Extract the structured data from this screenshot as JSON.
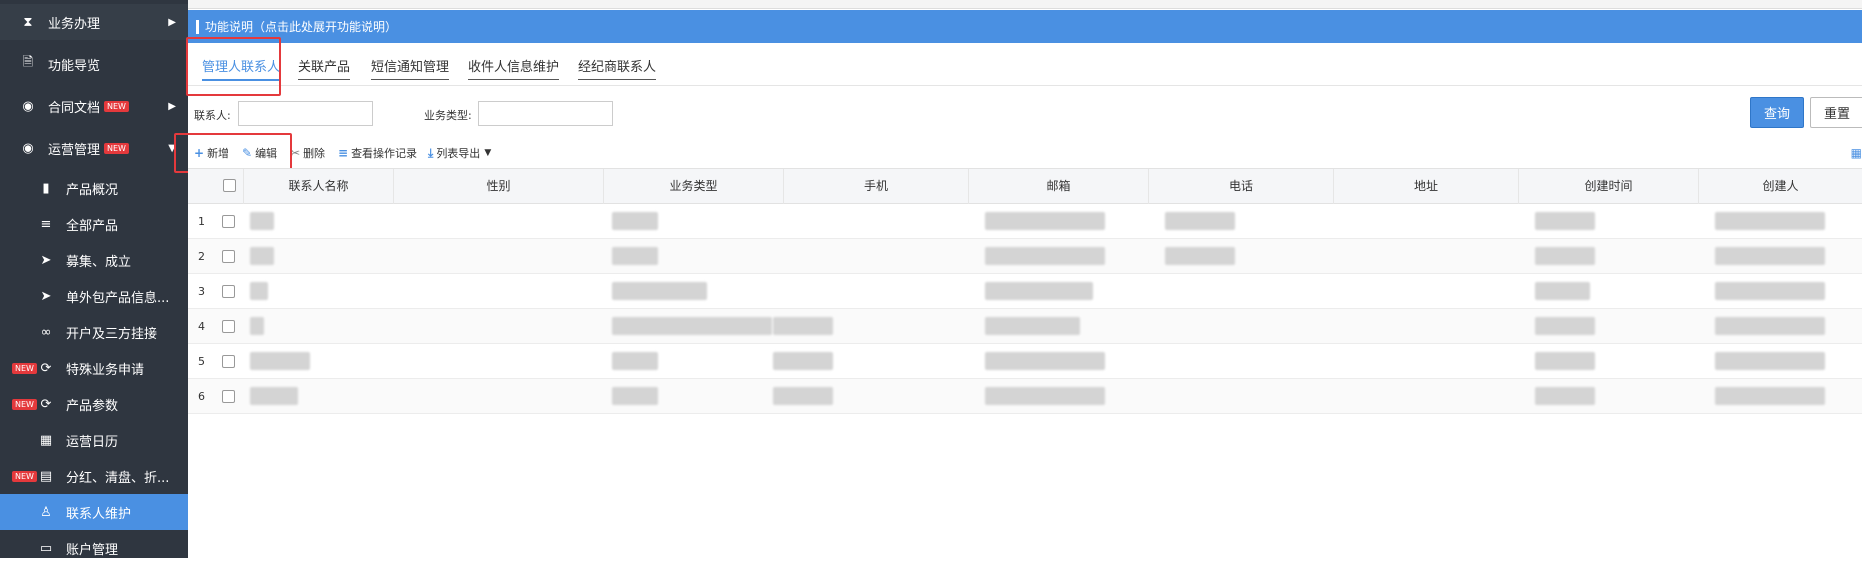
{
  "sidebar": {
    "items": [
      {
        "label": "业务办理",
        "icon": "hourglass-icon",
        "new": false,
        "arrow": true
      },
      {
        "label": "功能导览",
        "icon": "document-icon",
        "new": false,
        "arrow": false
      },
      {
        "label": "合同文档",
        "icon": "compass-icon",
        "new": true,
        "arrow": true
      },
      {
        "label": "运营管理",
        "icon": "compass-icon",
        "new": true,
        "arrow": true
      }
    ],
    "subitems": [
      {
        "label": "产品概况",
        "icon": "file-icon",
        "new": false
      },
      {
        "label": "全部产品",
        "icon": "list-icon",
        "new": false
      },
      {
        "label": "募集、成立",
        "icon": "send-icon",
        "new": false
      },
      {
        "label": "单外包产品信息...",
        "icon": "send-icon",
        "new": false
      },
      {
        "label": "开户及三方挂接",
        "icon": "link-icon",
        "new": false
      },
      {
        "label": "特殊业务申请",
        "icon": "refresh-icon",
        "new": true
      },
      {
        "label": "产品参数",
        "icon": "refresh-icon",
        "new": true
      },
      {
        "label": "运营日历",
        "icon": "calendar-icon",
        "new": false
      },
      {
        "label": "分红、清盘、折...",
        "icon": "calculator-icon",
        "new": true
      },
      {
        "label": "联系人维护",
        "icon": "user-icon",
        "new": false,
        "active": true
      },
      {
        "label": "账户管理",
        "icon": "card-icon",
        "new": false
      }
    ],
    "new_badge": "NEW"
  },
  "banner": {
    "text": "功能说明（点击此处展开功能说明）"
  },
  "tabs": [
    "管理人联系人",
    "关联产品",
    "短信通知管理",
    "收件人信息维护",
    "经纪商联系人"
  ],
  "filter": {
    "contact_label": "联系人:",
    "contact_value": "",
    "biz_label": "业务类型:",
    "biz_value": "",
    "query_button": "查询",
    "reset_button": "重置"
  },
  "toolbar": {
    "add": "新增",
    "edit": "编辑",
    "delete": "删除",
    "log": "查看操作记录",
    "export": "列表导出"
  },
  "table": {
    "columns": [
      "联系人名称",
      "性别",
      "业务类型",
      "手机",
      "邮箱",
      "电话",
      "地址",
      "创建时间",
      "创建人"
    ],
    "rows": [
      "1",
      "2",
      "3",
      "4",
      "5",
      "6"
    ]
  },
  "colors": {
    "accent": "#4a90e2",
    "sidebar": "#2f3640",
    "highlight": "#e4393c"
  }
}
